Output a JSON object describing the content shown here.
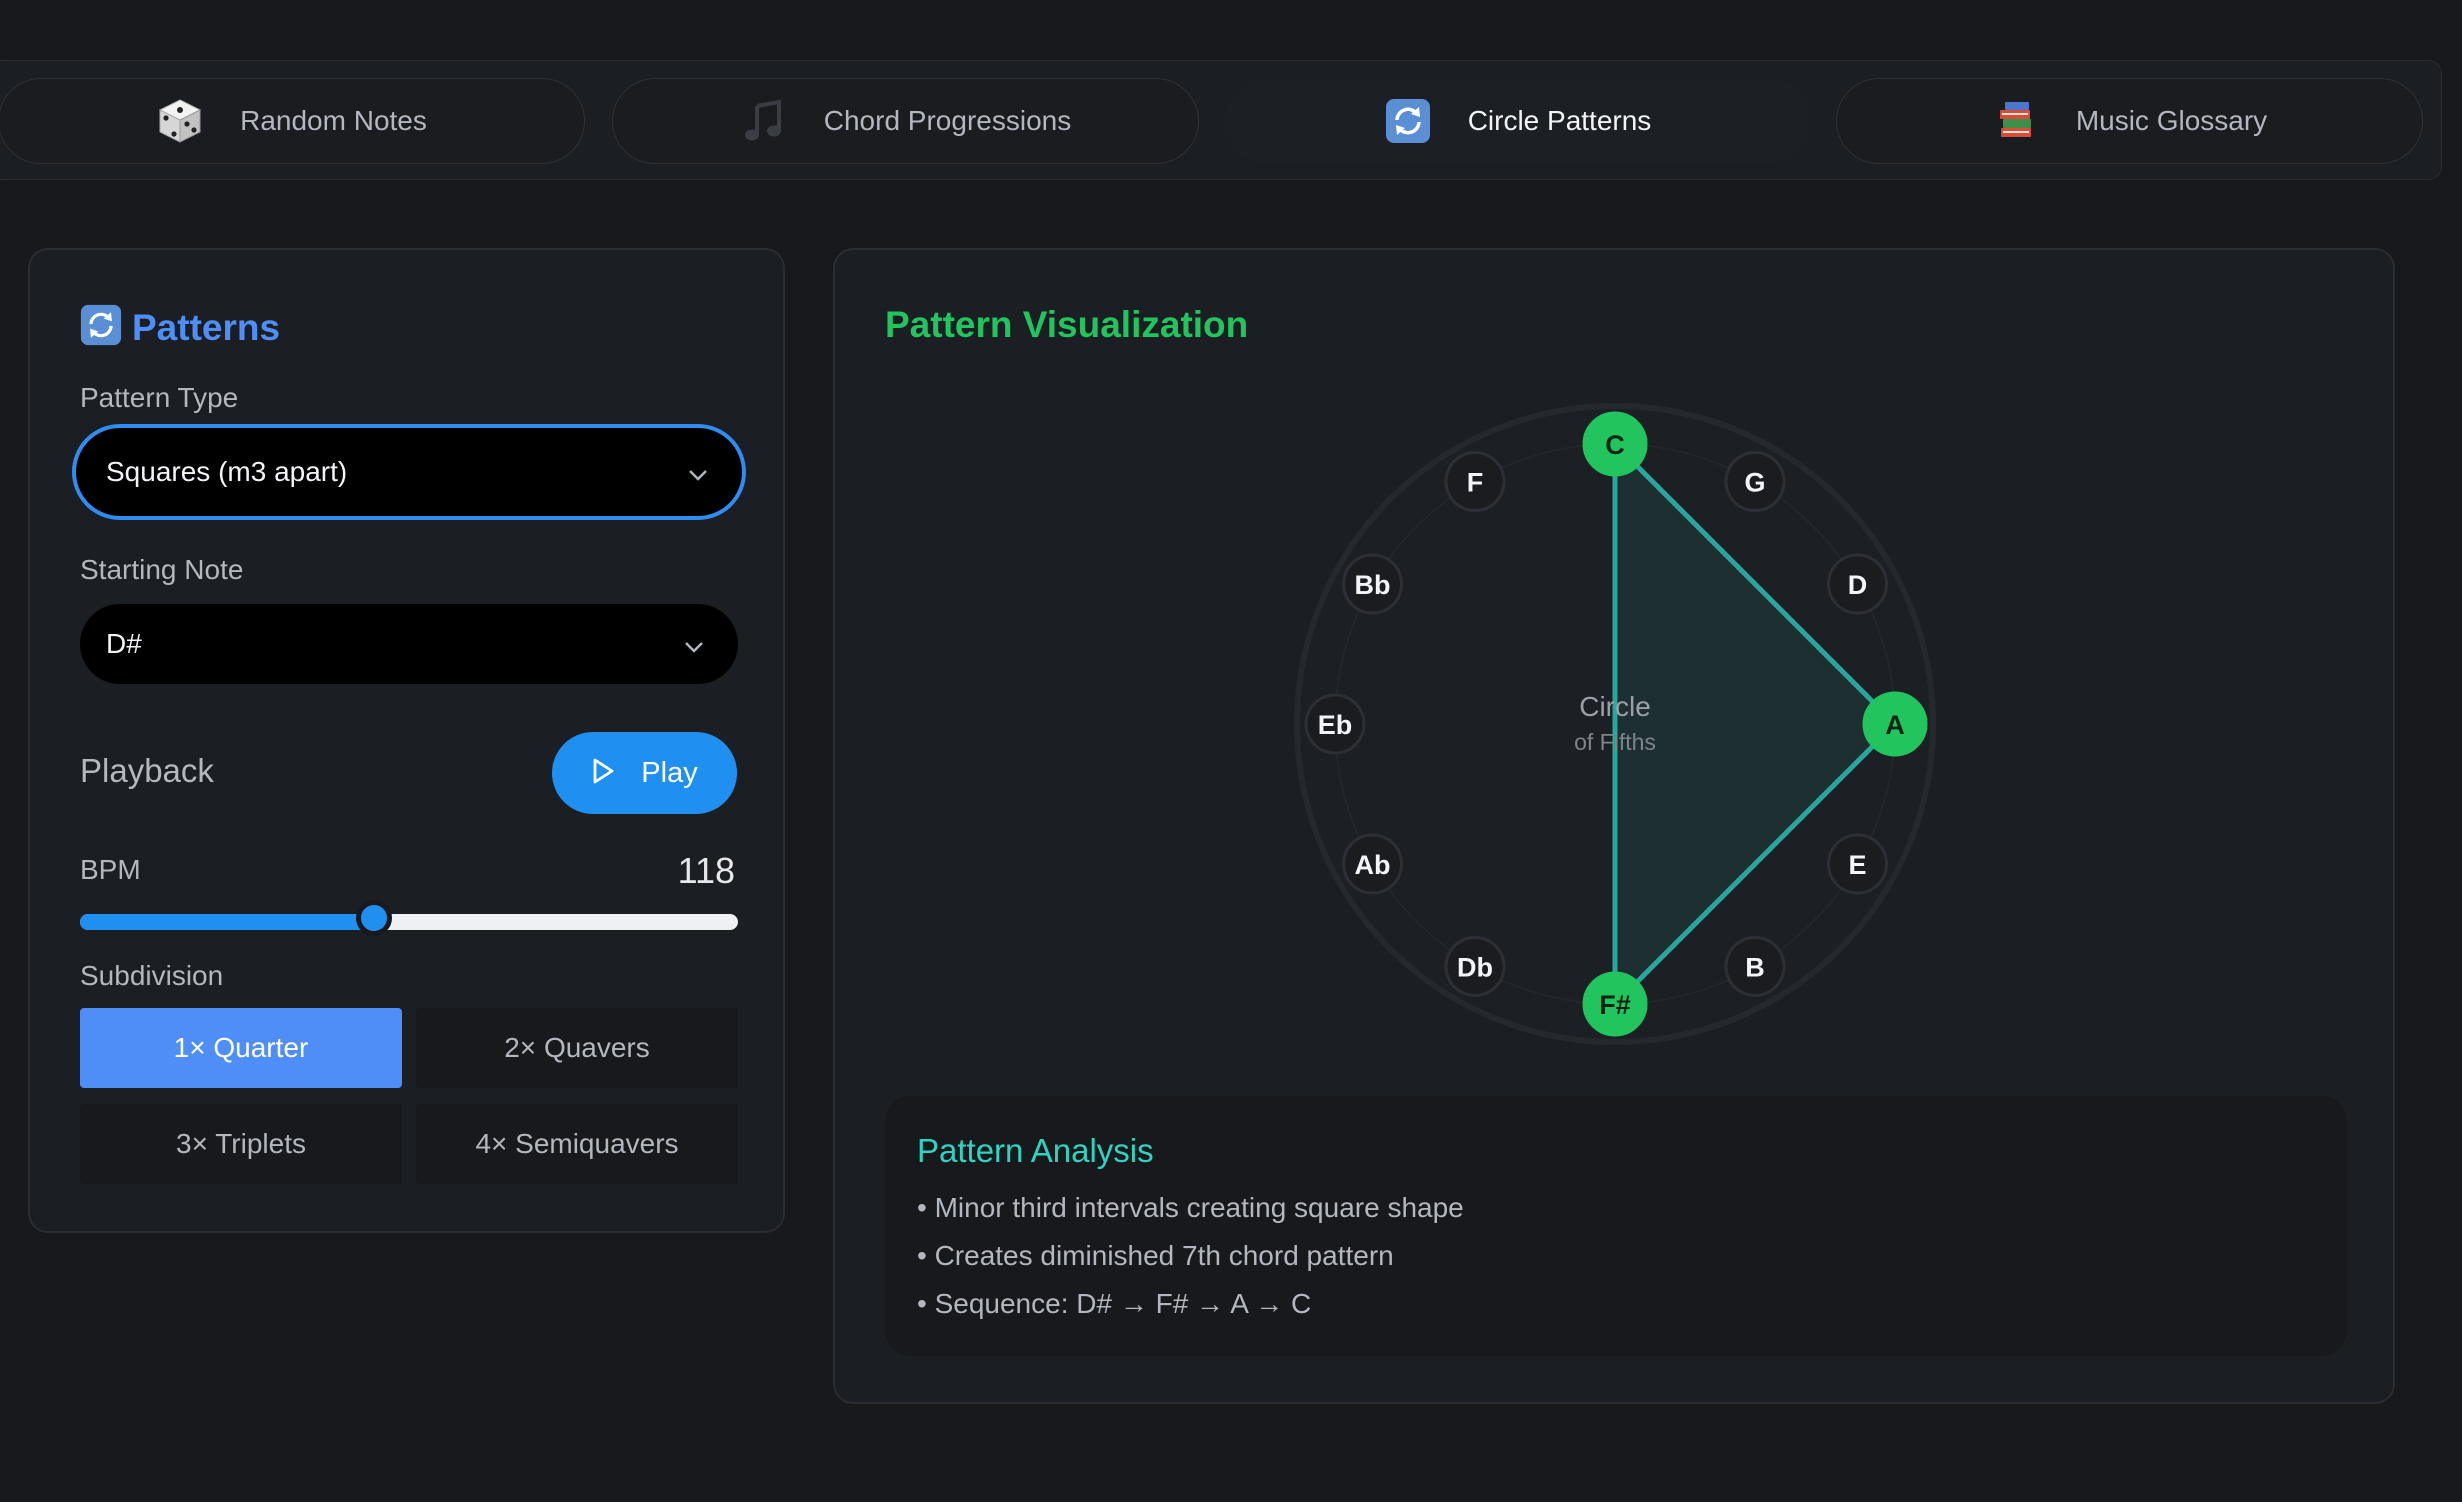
{
  "tabs": [
    {
      "label": "Random Notes",
      "icon": "dice-icon",
      "active": false
    },
    {
      "label": "Chord Progressions",
      "icon": "musical-note-icon",
      "active": false
    },
    {
      "label": "Circle Patterns",
      "icon": "cycle-arrows-icon",
      "active": true
    },
    {
      "label": "Music Glossary",
      "icon": "books-icon",
      "active": false
    }
  ],
  "left_panel": {
    "title": "Patterns",
    "title_icon": "cycle-arrows-icon",
    "pattern_type_label": "Pattern Type",
    "pattern_type_value": "Squares (m3 apart)",
    "starting_note_label": "Starting Note",
    "starting_note_value": "D#",
    "playback_label": "Playback",
    "play_label": "Play",
    "bpm_label": "BPM",
    "bpm_value": "118",
    "bpm_fraction": 0.447,
    "subdivision_label": "Subdivision",
    "subdivisions": [
      {
        "label": "1× Quarter",
        "active": true
      },
      {
        "label": "2× Quavers",
        "active": false
      },
      {
        "label": "3× Triplets",
        "active": false
      },
      {
        "label": "4× Semiquavers",
        "active": false
      }
    ]
  },
  "right_panel": {
    "title": "Pattern Visualization",
    "circle": {
      "center_line1": "Circle",
      "center_line2": "of Fifths",
      "notes": [
        "C",
        "G",
        "D",
        "A",
        "E",
        "B",
        "F#",
        "Db",
        "Ab",
        "Eb",
        "Bb",
        "F"
      ],
      "highlighted": [
        "C",
        "A",
        "F#"
      ],
      "pattern_sequence": [
        "C",
        "A",
        "F#"
      ]
    },
    "analysis": {
      "title": "Pattern Analysis",
      "items": [
        "• Minor third intervals creating square shape",
        "• Creates diminished 7th chord pattern",
        "• Sequence: D# → F# → A → C"
      ]
    }
  },
  "colors": {
    "accent_blue": "#1f8ff0",
    "title_blue": "#4f8ef7",
    "green": "#21c45d",
    "teal": "#2dd4bf",
    "background": "#17191d"
  }
}
